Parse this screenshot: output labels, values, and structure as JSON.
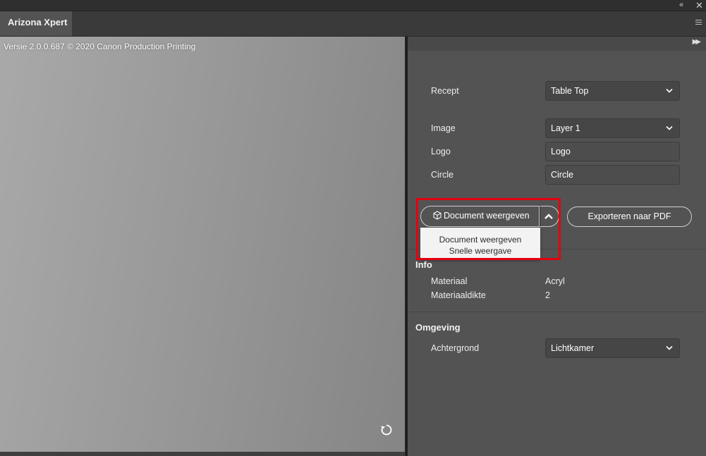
{
  "window": {
    "collapse_icon": "double-chevron-left",
    "close_icon": "close-x",
    "tab_title": "Arizona Xpert",
    "menu_icon": "hamburger-menu"
  },
  "preview": {
    "version_text": "Versie 2.0.0.687 © 2020 Canon Production Printing",
    "reload_icon": "rotate-refresh"
  },
  "panel": {
    "expand_icon": "double-chevron-right",
    "fields": {
      "recept": {
        "label": "Recept",
        "value": "Table Top"
      },
      "image": {
        "label": "Image",
        "value": "Layer 1"
      },
      "logo": {
        "label": "Logo",
        "value": "Logo"
      },
      "circle": {
        "label": "Circle",
        "value": "Circle"
      }
    },
    "view_button": {
      "label": "Document weergeven",
      "icon": "cube-icon"
    },
    "dropdown_toggle_icon": "chevron-up",
    "export_button": {
      "label": "Exporteren naar PDF"
    },
    "dropdown_options": [
      "Document weergeven",
      "Snelle weergave"
    ],
    "info": {
      "title": "Info",
      "materiaal": {
        "label": "Materiaal",
        "value": "Acryl"
      },
      "materiaaldikte": {
        "label": "Materiaaldikte",
        "value": "2"
      }
    },
    "omgeving": {
      "title": "Omgeving",
      "achtergrond": {
        "label": "Achtergrond",
        "value": "Lichtkamer"
      }
    }
  },
  "colors": {
    "panel_bg": "#535353",
    "highlight": "#e5000f"
  }
}
